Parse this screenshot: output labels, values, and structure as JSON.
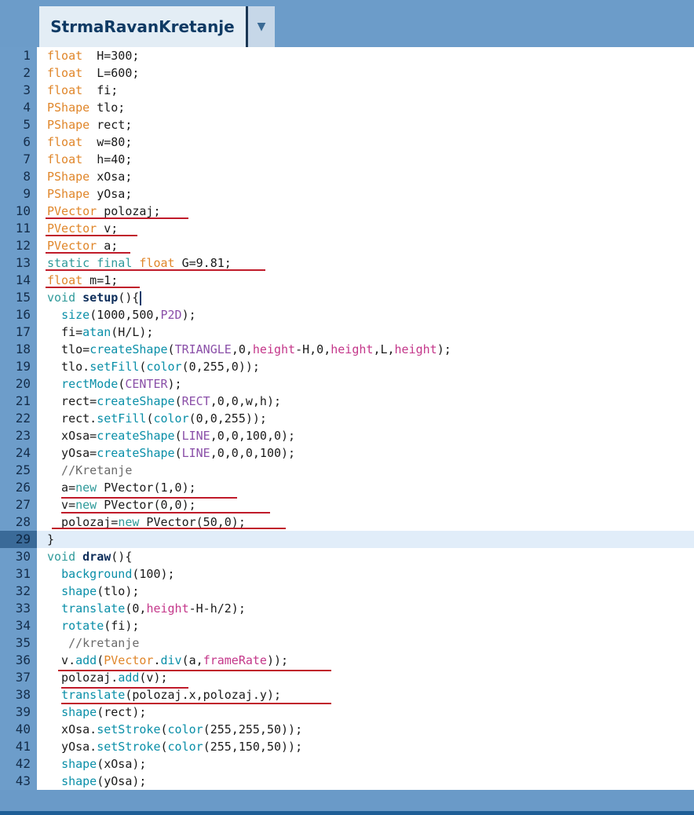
{
  "tab": {
    "title": "StrmaRavanKretanje",
    "menu_icon": "▼"
  },
  "editor": {
    "current_line": 29,
    "lines": [
      [
        [
          "kw",
          "float"
        ],
        [
          "",
          "  H=300;"
        ]
      ],
      [
        [
          "kw",
          "float"
        ],
        [
          "",
          "  L=600;"
        ]
      ],
      [
        [
          "kw",
          "float"
        ],
        [
          "",
          "  fi;"
        ]
      ],
      [
        [
          "kw",
          "PShape"
        ],
        [
          "",
          " tlo;"
        ]
      ],
      [
        [
          "kw",
          "PShape"
        ],
        [
          "",
          " rect;"
        ]
      ],
      [
        [
          "kw",
          "float"
        ],
        [
          "",
          "  w=80;"
        ]
      ],
      [
        [
          "kw",
          "float"
        ],
        [
          "",
          "  h=40;"
        ]
      ],
      [
        [
          "kw",
          "PShape"
        ],
        [
          "",
          " xOsa;"
        ]
      ],
      [
        [
          "kw",
          "PShape"
        ],
        [
          "",
          " yOsa;"
        ]
      ],
      [
        [
          "kw",
          "PVector"
        ],
        [
          "",
          " polozaj;"
        ]
      ],
      [
        [
          "kw",
          "PVector"
        ],
        [
          "",
          " v;"
        ]
      ],
      [
        [
          "kw",
          "PVector"
        ],
        [
          "",
          " a;"
        ]
      ],
      [
        [
          "kw2",
          "static final"
        ],
        [
          "",
          " "
        ],
        [
          "kw",
          "float"
        ],
        [
          "",
          " G=9.81;"
        ]
      ],
      [
        [
          "kw",
          "float"
        ],
        [
          "",
          " m=1;"
        ]
      ],
      [
        [
          "kw2",
          "void"
        ],
        [
          "",
          " "
        ],
        [
          "dfn",
          "setup"
        ],
        [
          "",
          "()"
        ],
        [
          "cursor",
          "{"
        ]
      ],
      [
        [
          "",
          "  "
        ],
        [
          "fn",
          "size"
        ],
        [
          "",
          "(1000,500,"
        ],
        [
          "cst",
          "P2D"
        ],
        [
          "",
          ");"
        ]
      ],
      [
        [
          "",
          "  fi="
        ],
        [
          "fn",
          "atan"
        ],
        [
          "",
          "(H/L);"
        ]
      ],
      [
        [
          "",
          "  tlo="
        ],
        [
          "fn",
          "createShape"
        ],
        [
          "",
          "("
        ],
        [
          "cst",
          "TRIANGLE"
        ],
        [
          "",
          ",0,"
        ],
        [
          "var",
          "height"
        ],
        [
          "",
          "-H,0,"
        ],
        [
          "var",
          "height"
        ],
        [
          "",
          ",L,"
        ],
        [
          "var",
          "height"
        ],
        [
          "",
          ");"
        ]
      ],
      [
        [
          "",
          "  tlo."
        ],
        [
          "fn",
          "setFill"
        ],
        [
          "",
          "("
        ],
        [
          "fn",
          "color"
        ],
        [
          "",
          "(0,255,0));"
        ]
      ],
      [
        [
          "",
          "  "
        ],
        [
          "fn",
          "rectMode"
        ],
        [
          "",
          "("
        ],
        [
          "cst",
          "CENTER"
        ],
        [
          "",
          ");"
        ]
      ],
      [
        [
          "",
          "  rect="
        ],
        [
          "fn",
          "createShape"
        ],
        [
          "",
          "("
        ],
        [
          "cst",
          "RECT"
        ],
        [
          "",
          ",0,0,w,h);"
        ]
      ],
      [
        [
          "",
          "  rect."
        ],
        [
          "fn",
          "setFill"
        ],
        [
          "",
          "("
        ],
        [
          "fn",
          "color"
        ],
        [
          "",
          "(0,0,255));"
        ]
      ],
      [
        [
          "",
          "  xOsa="
        ],
        [
          "fn",
          "createShape"
        ],
        [
          "",
          "("
        ],
        [
          "cst",
          "LINE"
        ],
        [
          "",
          ",0,0,100,0);"
        ]
      ],
      [
        [
          "",
          "  yOsa="
        ],
        [
          "fn",
          "createShape"
        ],
        [
          "",
          "("
        ],
        [
          "cst",
          "LINE"
        ],
        [
          "",
          ",0,0,0,100);"
        ]
      ],
      [
        [
          "cm",
          "  //Kretanje"
        ]
      ],
      [
        [
          "",
          "  a="
        ],
        [
          "kw2",
          "new"
        ],
        [
          "",
          " PVector(1,0);"
        ]
      ],
      [
        [
          "",
          "  v="
        ],
        [
          "kw2",
          "new"
        ],
        [
          "",
          " PVector(0,0);"
        ]
      ],
      [
        [
          "",
          "  polozaj="
        ],
        [
          "kw2",
          "new"
        ],
        [
          "",
          " PVector(50,0);"
        ]
      ],
      [
        [
          "",
          "}"
        ]
      ],
      [
        [
          "kw2",
          "void"
        ],
        [
          "",
          " "
        ],
        [
          "dfn",
          "draw"
        ],
        [
          "",
          "(){"
        ]
      ],
      [
        [
          "",
          "  "
        ],
        [
          "fn",
          "background"
        ],
        [
          "",
          "(100);"
        ]
      ],
      [
        [
          "",
          "  "
        ],
        [
          "fn",
          "shape"
        ],
        [
          "",
          "(tlo);"
        ]
      ],
      [
        [
          "",
          "  "
        ],
        [
          "fn",
          "translate"
        ],
        [
          "",
          "(0,"
        ],
        [
          "var",
          "height"
        ],
        [
          "",
          "-H-h/2);"
        ]
      ],
      [
        [
          "",
          "  "
        ],
        [
          "fn",
          "rotate"
        ],
        [
          "",
          "(fi);"
        ]
      ],
      [
        [
          "cm",
          "   //kretanje"
        ]
      ],
      [
        [
          "",
          "  v."
        ],
        [
          "fn",
          "add"
        ],
        [
          "",
          "("
        ],
        [
          "kw",
          "PVector"
        ],
        [
          "",
          "."
        ],
        [
          "fn",
          "div"
        ],
        [
          "",
          "(a,"
        ],
        [
          "var",
          "frameRate"
        ],
        [
          "",
          "));"
        ]
      ],
      [
        [
          "",
          "  polozaj."
        ],
        [
          "fn",
          "add"
        ],
        [
          "",
          "(v);"
        ]
      ],
      [
        [
          "",
          "  "
        ],
        [
          "fn",
          "translate"
        ],
        [
          "",
          "(polozaj.x,polozaj.y);"
        ]
      ],
      [
        [
          "",
          "  "
        ],
        [
          "fn",
          "shape"
        ],
        [
          "",
          "(rect);"
        ]
      ],
      [
        [
          "",
          "  xOsa."
        ],
        [
          "fn",
          "setStroke"
        ],
        [
          "",
          "("
        ],
        [
          "fn",
          "color"
        ],
        [
          "",
          "(255,255,50));"
        ]
      ],
      [
        [
          "",
          "  yOsa."
        ],
        [
          "fn",
          "setStroke"
        ],
        [
          "",
          "("
        ],
        [
          "fn",
          "color"
        ],
        [
          "",
          "(255,150,50));"
        ]
      ],
      [
        [
          "",
          "  "
        ],
        [
          "fn",
          "shape"
        ],
        [
          "",
          "(xOsa);"
        ]
      ],
      [
        [
          "",
          "  "
        ],
        [
          "fn",
          "shape"
        ],
        [
          "",
          "(yOsa);"
        ]
      ]
    ]
  }
}
